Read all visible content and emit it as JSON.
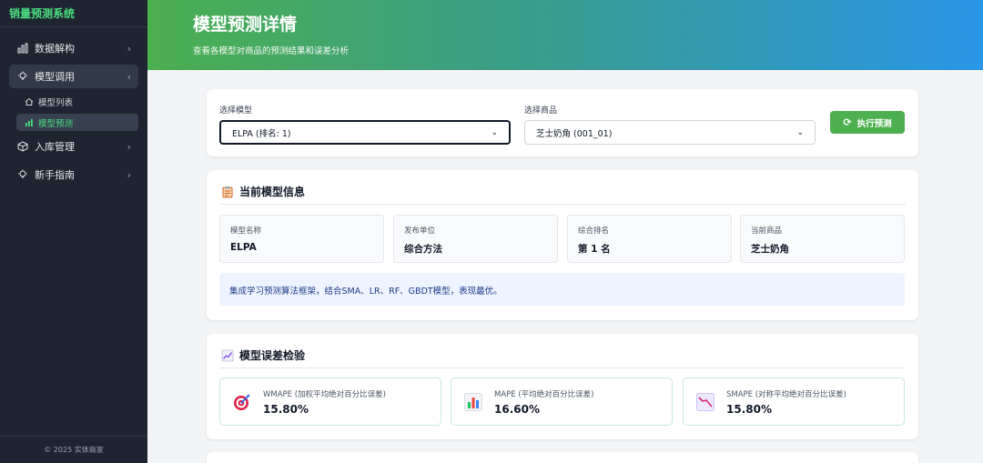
{
  "sidebar": {
    "brand": "销量预测系统",
    "items": [
      {
        "label": "数据解构"
      },
      {
        "label": "模型调用"
      },
      {
        "label": "入库管理"
      },
      {
        "label": "新手指南"
      }
    ],
    "subitems": [
      {
        "label": "模型列表"
      },
      {
        "label": "模型预测"
      }
    ],
    "footer": "© 2025 实体商家"
  },
  "header": {
    "title": "模型预测详情",
    "subtitle": "查看各模型对商品的预测结果和误差分析"
  },
  "controls": {
    "model_label": "选择模型",
    "model_value": "ELPA (排名: 1)",
    "product_label": "选择商品",
    "product_value": "芝士奶角 (001_01)",
    "run_label": "执行预测"
  },
  "model_info": {
    "title": "当前模型信息",
    "fields": [
      {
        "key": "模型名称",
        "value": "ELPA"
      },
      {
        "key": "发布单位",
        "value": "综合方法"
      },
      {
        "key": "综合排名",
        "value": "第 1 名"
      },
      {
        "key": "当前商品",
        "value": "芝士奶角"
      }
    ],
    "description": "集成学习预测算法框架，结合SMA、LR、RF、GBDT模型，表现最优。"
  },
  "error_check": {
    "title": "模型误差检验",
    "metrics": [
      {
        "key": "WMAPE (加权平均绝对百分比误差)",
        "value": "15.80%"
      },
      {
        "key": "MAPE (平均绝对百分比误差)",
        "value": "16.60%"
      },
      {
        "key": "SMAPE (对称平均绝对百分比误差)",
        "value": "15.80%"
      }
    ]
  },
  "colors": {
    "accent": "#4caf50",
    "sidebar_bg": "#1f2530",
    "header_start": "#4caf50",
    "header_end": "#2a96e8"
  }
}
